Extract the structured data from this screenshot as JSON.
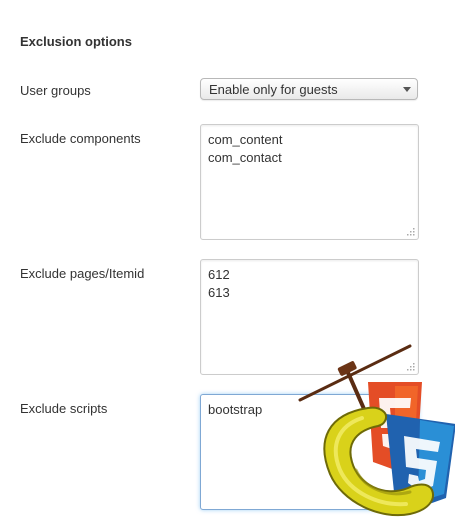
{
  "section": {
    "title": "Exclusion options"
  },
  "user_groups": {
    "label": "User groups",
    "selected": "Enable only for guests"
  },
  "exclude_components": {
    "label": "Exclude components",
    "lines": [
      "com_content",
      "com_contact"
    ]
  },
  "exclude_pages": {
    "label": "Exclude pages/Itemid",
    "lines": [
      "612",
      "613"
    ]
  },
  "exclude_scripts": {
    "label": "Exclude scripts",
    "lines": [
      "bootstrap"
    ]
  },
  "logo": {
    "name": "html5-css3-clamp-logo"
  },
  "colors": {
    "text": "#333333",
    "focus_border": "#7fa8d4",
    "clamp_yellow": "#d9d21a",
    "html5_orange": "#e44d26",
    "css3_blue": "#2a8fd6"
  }
}
